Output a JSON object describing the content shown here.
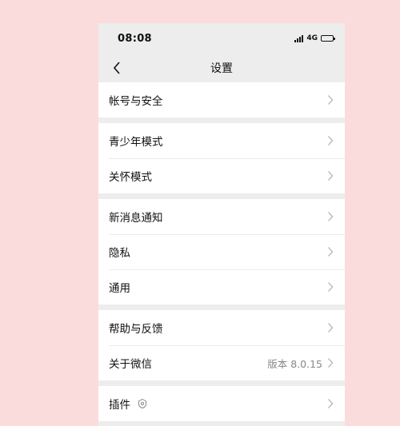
{
  "status": {
    "time": "08:08",
    "network": "4G"
  },
  "nav": {
    "title": "设置"
  },
  "groups": [
    {
      "items": [
        {
          "label": "帐号与安全"
        }
      ]
    },
    {
      "items": [
        {
          "label": "青少年模式"
        },
        {
          "label": "关怀模式"
        }
      ]
    },
    {
      "items": [
        {
          "label": "新消息通知"
        },
        {
          "label": "隐私"
        },
        {
          "label": "通用"
        }
      ]
    },
    {
      "items": [
        {
          "label": "帮助与反馈"
        },
        {
          "label": "关于微信",
          "value": "版本 8.0.15"
        }
      ]
    },
    {
      "items": [
        {
          "label": "插件",
          "icon": "plugin-icon"
        }
      ]
    }
  ],
  "colors": {
    "background": "#fbdcdc",
    "screen": "#ededed",
    "card": "#ffffff"
  }
}
